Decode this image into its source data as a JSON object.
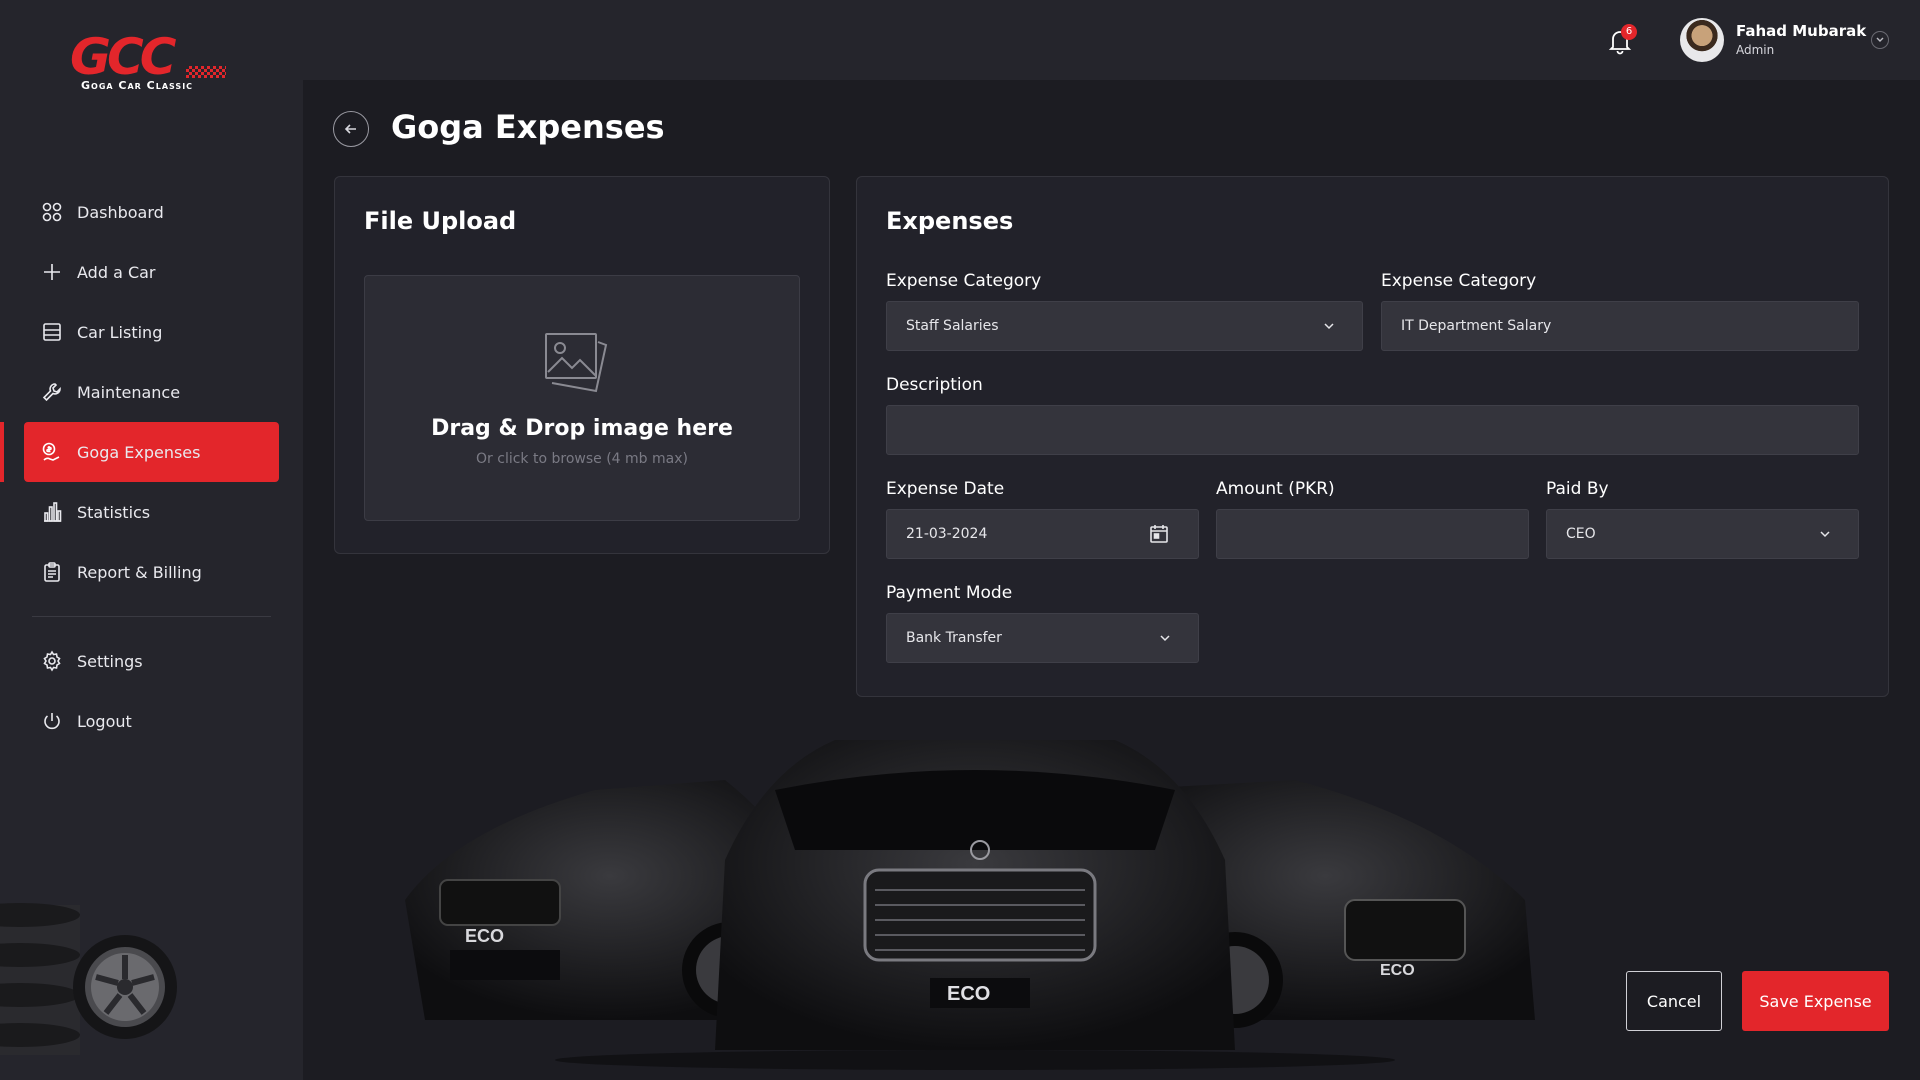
{
  "brand": {
    "logo_mark": "GCC",
    "logo_subtitle": "Goga Car Classic"
  },
  "sidebar": {
    "items": [
      {
        "label": "Dashboard",
        "icon": "grid-icon"
      },
      {
        "label": "Add a Car",
        "icon": "plus-icon"
      },
      {
        "label": "Car Listing",
        "icon": "list-icon"
      },
      {
        "label": "Maintenance",
        "icon": "wrench-icon"
      },
      {
        "label": "Goga Expenses",
        "icon": "expenses-icon",
        "active": true
      },
      {
        "label": "Statistics",
        "icon": "bar-chart-icon"
      },
      {
        "label": "Report & Billing",
        "icon": "clipboard-icon"
      }
    ],
    "bottom_items": [
      {
        "label": "Settings",
        "icon": "gear-icon"
      },
      {
        "label": "Logout",
        "icon": "power-icon"
      }
    ]
  },
  "topbar": {
    "notification_count": "6",
    "user_name": "Fahad Mubarak",
    "user_role": "Admin"
  },
  "page": {
    "title": "Goga Expenses"
  },
  "upload": {
    "title": "File Upload",
    "drop_title": "Drag & Drop image here",
    "drop_subtitle": "Or click to browse (4 mb max)"
  },
  "expenses": {
    "title": "Expenses",
    "category_label": "Expense Category",
    "category_value": "Staff Salaries",
    "subcategory_label": "Expense Category",
    "subcategory_value": "IT Department Salary",
    "description_label": "Description",
    "description_value": "",
    "date_label": "Expense Date",
    "date_value": "21-03-2024",
    "amount_label": "Amount (PKR)",
    "amount_value": "",
    "paid_by_label": "Paid By",
    "paid_by_value": "CEO",
    "payment_mode_label": "Payment Mode",
    "payment_mode_value": "Bank Transfer"
  },
  "car_plates": [
    "ECO",
    "ECO",
    "ECO"
  ],
  "actions": {
    "cancel_label": "Cancel",
    "save_label": "Save Expense"
  },
  "colors": {
    "accent": "#e3262b",
    "background": "#1c1c22",
    "sidebar": "#25252c"
  }
}
